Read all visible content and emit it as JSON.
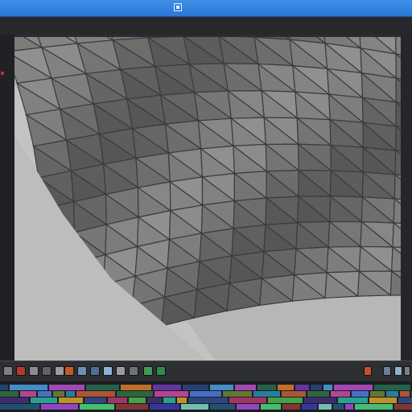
{
  "window": {
    "title": "",
    "subtitle": ""
  },
  "colors": {
    "titlebar": "#2a78d6",
    "viewport_bg": "#b7b8b6",
    "mesh_face": "#8f918f",
    "mesh_edge": "#3a3b3c",
    "record": "#c62b2b"
  },
  "toolbar": {
    "left_buttons": [
      {
        "icon": "stop-icon"
      },
      {
        "icon": "record-icon"
      },
      {
        "icon": "camera-icon"
      },
      {
        "icon": "frame-icon"
      },
      {
        "icon": "move-icon"
      },
      {
        "icon": "keyframe-icon"
      },
      {
        "icon": "key-icon"
      },
      {
        "icon": "display-icon"
      },
      {
        "icon": "monitor-icon"
      },
      {
        "icon": "grid-icon"
      },
      {
        "icon": "film-icon"
      },
      {
        "icon": "render-icon"
      },
      {
        "icon": "play-icon"
      }
    ],
    "right_buttons": [
      {
        "icon": "render-settings-icon"
      },
      {
        "icon": "view-icon"
      },
      {
        "icon": "maximize-icon"
      },
      {
        "icon": "layout-icon"
      }
    ]
  },
  "timeline": {
    "tracks": [
      "track-1",
      "track-2",
      "track-3",
      "track-4"
    ]
  }
}
